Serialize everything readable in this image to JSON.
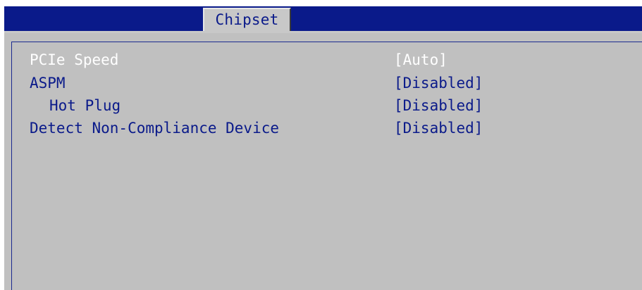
{
  "header": {
    "tab_label": "Chipset"
  },
  "settings": [
    {
      "label": "PCIe Speed",
      "value": "[Auto]",
      "selected": true,
      "indent": false
    },
    {
      "label": "ASPM",
      "value": "[Disabled]",
      "selected": false,
      "indent": false
    },
    {
      "label": "Hot Plug",
      "value": "[Disabled]",
      "selected": false,
      "indent": true
    },
    {
      "label": "Detect Non-Compliance Device",
      "value": "[Disabled]",
      "selected": false,
      "indent": false
    }
  ],
  "colors": {
    "header_bar": "#0a1a8a",
    "panel_background": "#c0c0c0",
    "text": "#0a1a8a",
    "selected_text": "#ffffff"
  }
}
